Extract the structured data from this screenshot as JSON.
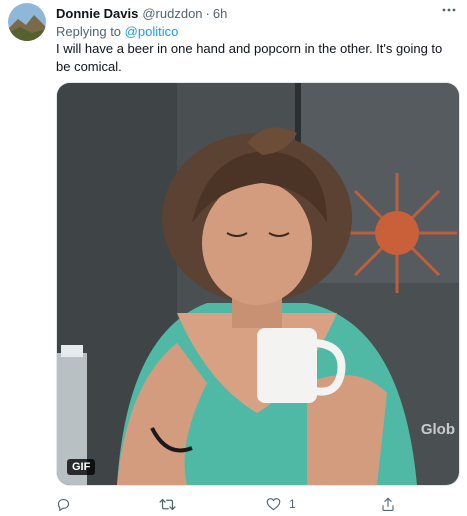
{
  "author": {
    "name": "Donnie Davis",
    "handle": "@rudzdon",
    "time": "6h"
  },
  "reply": {
    "prefix": "Replying to",
    "mention": "@politico"
  },
  "tweet": {
    "text": "I will have a beer in one hand and popcorn in the other. It's going to be comical."
  },
  "media": {
    "badge": "GIF",
    "watermark": "Glob"
  },
  "actions": {
    "reply_count": "",
    "retweet_count": "",
    "like_count": "1",
    "share_count": ""
  },
  "icons": {
    "more": "more-horizontal-icon",
    "reply": "reply-icon",
    "retweet": "retweet-icon",
    "like": "heart-icon",
    "share": "share-icon"
  },
  "colors": {
    "link": "#1d9bf0",
    "muted": "#536471",
    "text": "#0f1419",
    "shirt": "#4fb9a6"
  }
}
